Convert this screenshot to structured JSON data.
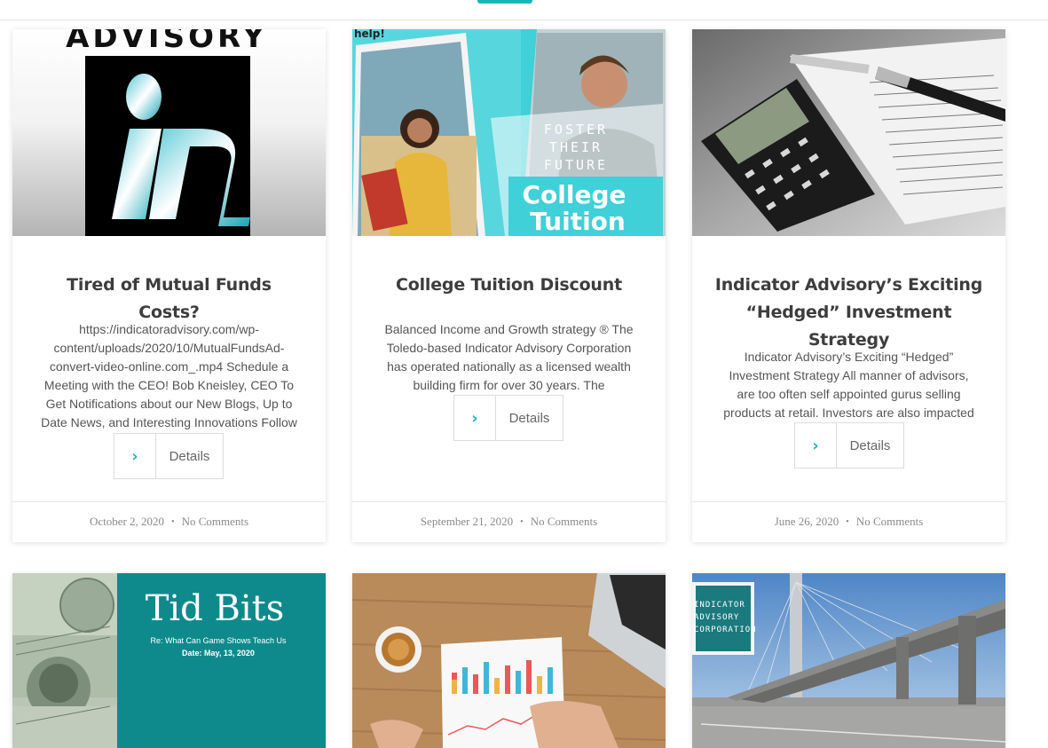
{
  "posts": [
    {
      "image_alt": "Indicator Advisory logo",
      "image_text": "ADVISORY",
      "title": "Tired of Mutual Funds Costs?",
      "excerpt": "https://indicatoradvisory.com/wp-content/uploads/2020/10/MutualFundsAd-convert-video-online.com_.mp4 Schedule a Meeting with the CEO! Bob Kneisley, CEO To Get Notifications about our New Blogs, Up to Date News, and Interesting Innovations Follow",
      "button_label": "Details",
      "date": "October 2, 2020",
      "comments": "No Comments"
    },
    {
      "image_alt": "College tuition students",
      "image_text_1": "help!",
      "image_text_2": "FOSTER",
      "image_text_3": "THEIR",
      "image_text_4": "FUTURE",
      "image_text_5": "College",
      "image_text_6": "Tuition",
      "title": "College Tuition Discount",
      "excerpt": "Balanced Income and Growth strategy ® The Toledo-based Indicator Advisory Corporation has operated nationally as a licensed wealth building firm for over 30 years. The",
      "button_label": "Details",
      "date": "September 21, 2020",
      "comments": "No Comments"
    },
    {
      "image_alt": "Calculator and pen on financial papers",
      "title": "Indicator Advisory’s Exciting “Hedged” Investment Strategy",
      "excerpt": "Indicator Advisory’s Exciting “Hedged” Investment Strategy All manner of advisors, are too often self appointed gurus selling products at retail. Investors are also impacted by",
      "button_label": "Details",
      "date": "June 26, 2020",
      "comments": "No Comments"
    },
    {
      "image_alt": "Tid Bits dollar bills",
      "image_text_1": "Tid Bits",
      "image_text_2": "Re: What Can Game Shows Teach Us",
      "image_text_3": "Date: May, 13, 2020"
    },
    {
      "image_alt": "Charts with coffee and laptop"
    },
    {
      "image_alt": "Bridge highway",
      "image_text_1": "INDICATOR",
      "image_text_2": "ADVISORY",
      "image_text_3": "CORPORATION"
    }
  ],
  "colors": {
    "accent": "#1bb6b6",
    "title": "#3d3d3d",
    "text": "#555555",
    "meta": "#8a8a8a"
  },
  "icons": {
    "details": "chevron-right-icon"
  }
}
